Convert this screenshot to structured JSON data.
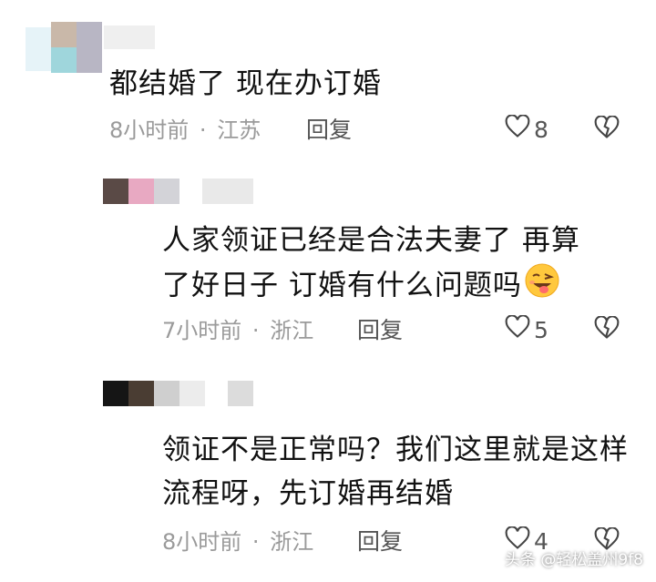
{
  "comments": [
    {
      "text": "都结婚了 现在办订婚",
      "time": "8小时前",
      "separator": "·",
      "location": "江苏",
      "reply_label": "回复",
      "likes": "8"
    },
    {
      "text": "人家领证已经是合法夫妻了 再算了好日子 订婚有什么问题吗",
      "time": "7小时前",
      "separator": "·",
      "location": "浙江",
      "reply_label": "回复",
      "likes": "5"
    },
    {
      "text": "领证不是正常吗？我们这里就是这样流程呀，先订婚再结婚",
      "time": "8小时前",
      "separator": "·",
      "location": "浙江",
      "reply_label": "回复",
      "likes": "4"
    }
  ],
  "watermark": "头条 @轻松盖州9f8",
  "colors": {
    "text": "#111111",
    "meta": "#9a9a9a",
    "icon": "#444444"
  }
}
